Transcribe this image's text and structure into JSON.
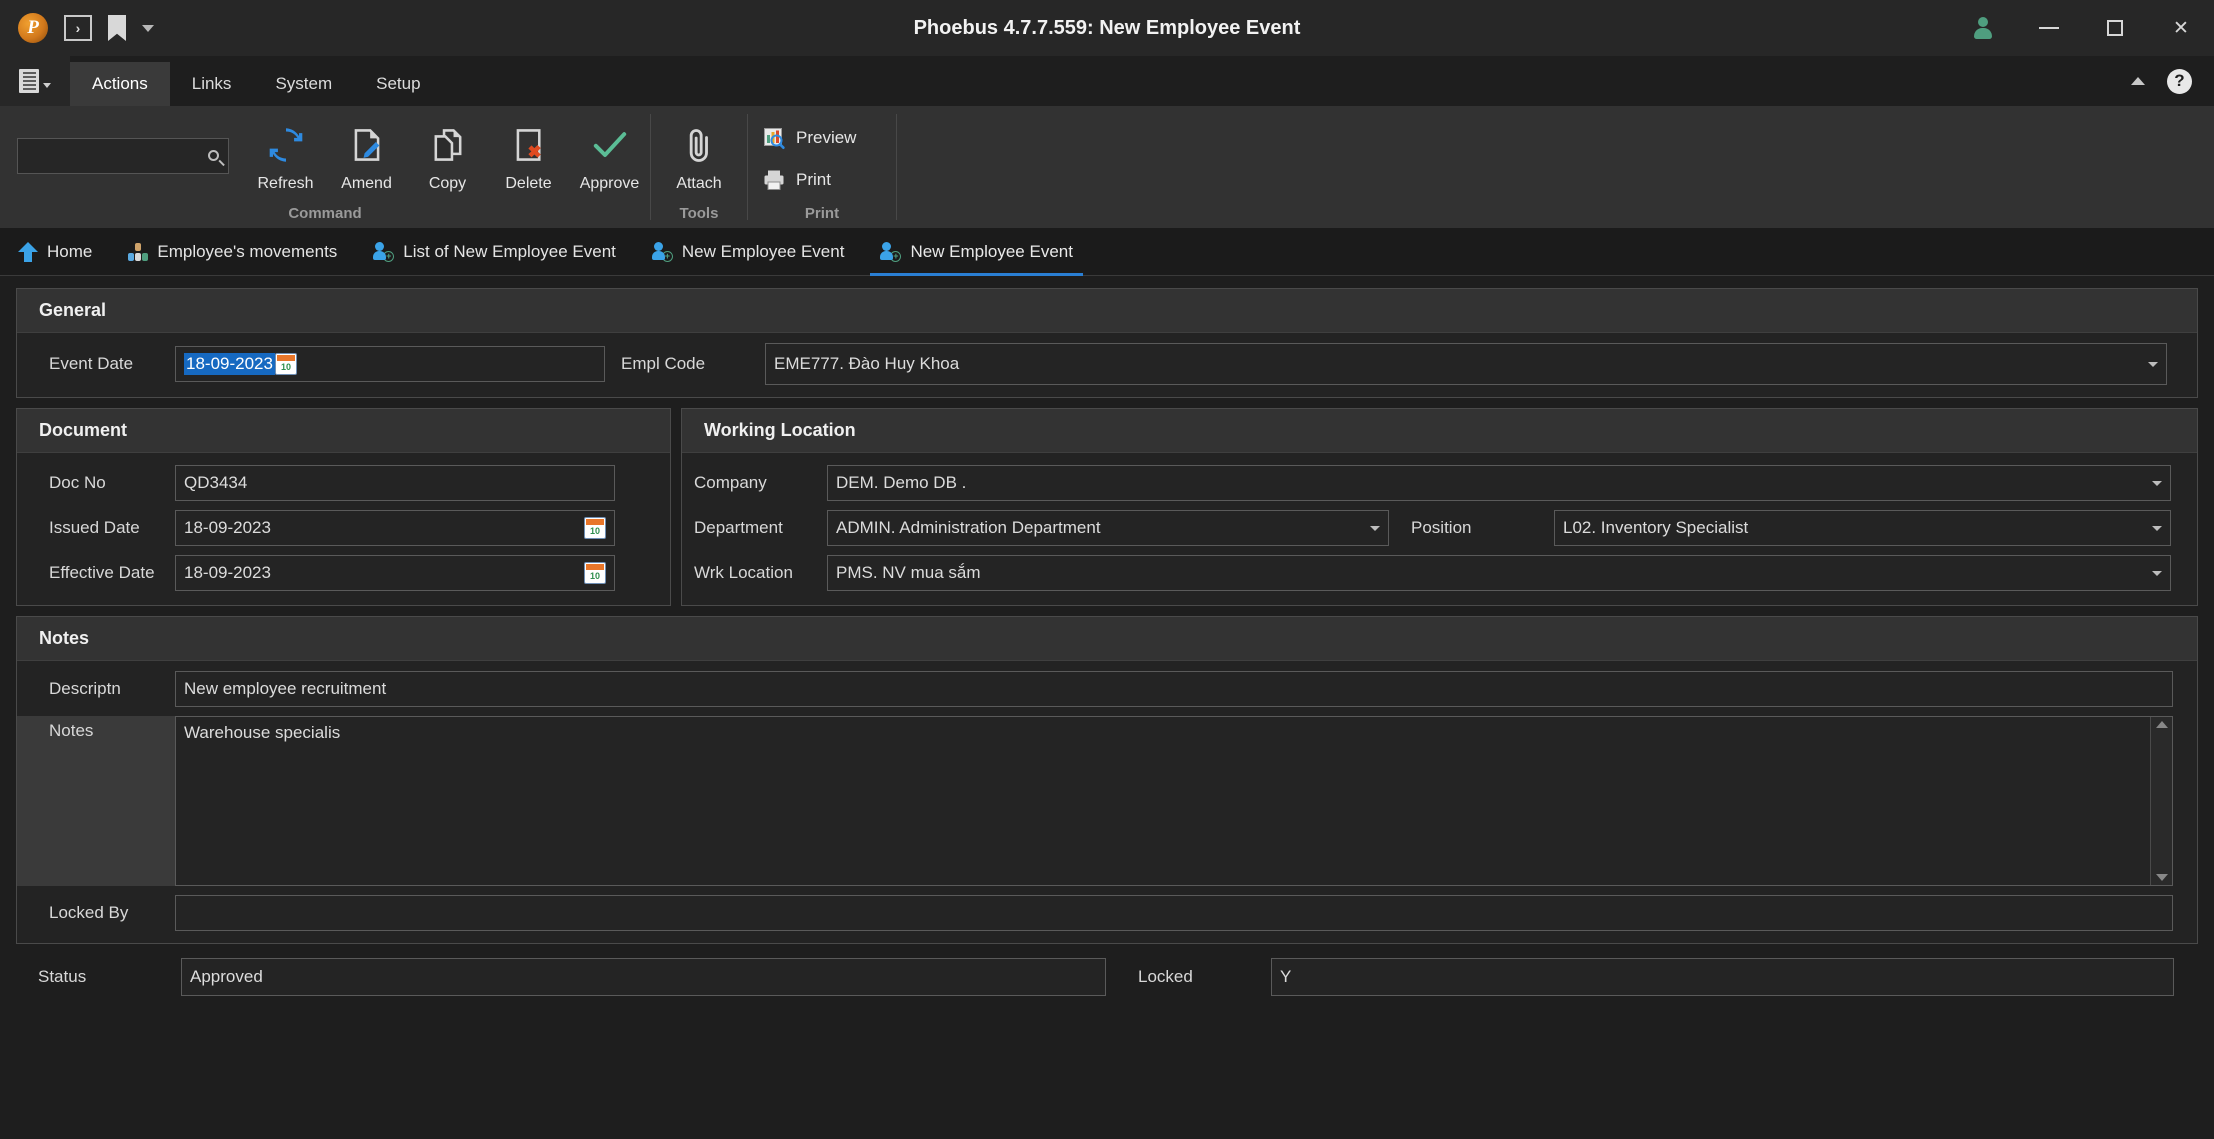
{
  "window": {
    "title": "Phoebus 4.7.7.559: New Employee Event",
    "logo_letter": "P",
    "quick_access": [
      {
        "name": "console-icon",
        "glyph": "›"
      },
      {
        "name": "bookmark-icon",
        "glyph": ""
      },
      {
        "name": "qat-dropdown-icon",
        "glyph": ""
      }
    ],
    "controls": {
      "user": "user-icon",
      "minimize": "—",
      "maximize": "□",
      "close": "✕"
    }
  },
  "menu": {
    "app_button": "application-menu",
    "tabs": [
      {
        "label": "Actions",
        "active": true
      },
      {
        "label": "Links",
        "active": false
      },
      {
        "label": "System",
        "active": false
      },
      {
        "label": "Setup",
        "active": false
      }
    ],
    "collapse_icon": "chevron-up-icon",
    "help_icon": "?"
  },
  "ribbon": {
    "search": {
      "value": "",
      "placeholder": ""
    },
    "groups": [
      {
        "label": "Command",
        "buttons": [
          {
            "label": "Refresh",
            "icon": "refresh-icon"
          },
          {
            "label": "Amend",
            "icon": "amend-icon"
          },
          {
            "label": "Copy",
            "icon": "copy-icon"
          },
          {
            "label": "Delete",
            "icon": "delete-icon"
          },
          {
            "label": "Approve",
            "icon": "approve-icon"
          }
        ]
      },
      {
        "label": "Tools",
        "buttons": [
          {
            "label": "Attach",
            "icon": "attach-icon"
          }
        ]
      },
      {
        "label": "Print",
        "buttons": [
          {
            "label": "Preview",
            "icon": "preview-icon"
          },
          {
            "label": "Print",
            "icon": "print-icon"
          }
        ]
      }
    ]
  },
  "tabstrip": [
    {
      "label": "Home",
      "icon": "home-icon",
      "active": false
    },
    {
      "label": "Employee's movements",
      "icon": "org-chart-icon",
      "active": false
    },
    {
      "label": "List of New Employee Event",
      "icon": "employee-add-icon",
      "active": false
    },
    {
      "label": "New Employee Event",
      "icon": "employee-add-icon",
      "active": false
    },
    {
      "label": "New Employee Event",
      "icon": "employee-add-icon",
      "active": true
    }
  ],
  "form": {
    "general": {
      "title": "General",
      "event_date": {
        "label": "Event Date",
        "value": "18-09-2023",
        "selected": true
      },
      "empl_code": {
        "label": "Empl Code",
        "value": "EME777.  Đào Huy Khoa"
      }
    },
    "document": {
      "title": "Document",
      "doc_no": {
        "label": "Doc No",
        "value": "QD3434"
      },
      "issued_date": {
        "label": "Issued Date",
        "value": "18-09-2023"
      },
      "effective_date": {
        "label": "Effective Date",
        "value": "18-09-2023"
      }
    },
    "working_location": {
      "title": "Working Location",
      "company": {
        "label": "Company",
        "value": "DEM. Demo DB ."
      },
      "department": {
        "label": "Department",
        "value": "ADMIN. Administration Department"
      },
      "position": {
        "label": "Position",
        "value": "L02. Inventory Specialist"
      },
      "wrk_location": {
        "label": "Wrk Location",
        "value": "PMS. NV mua sắm"
      }
    },
    "notes": {
      "title": "Notes",
      "descriptn": {
        "label": "Descriptn",
        "value": "New employee recruitment"
      },
      "notes": {
        "label": "Notes",
        "value": "Warehouse specialis"
      },
      "locked_by": {
        "label": "Locked By",
        "value": ""
      }
    },
    "status": {
      "status": {
        "label": "Status",
        "value": "Approved"
      },
      "locked": {
        "label": "Locked",
        "value": "Y"
      }
    }
  },
  "colors": {
    "accent": "#2a7fd4",
    "selection": "#1669c1",
    "panel_header": "#333333",
    "window_bg": "#1e1e1e",
    "approve_green": "#5bbd96",
    "delete_red": "#e04a20"
  }
}
